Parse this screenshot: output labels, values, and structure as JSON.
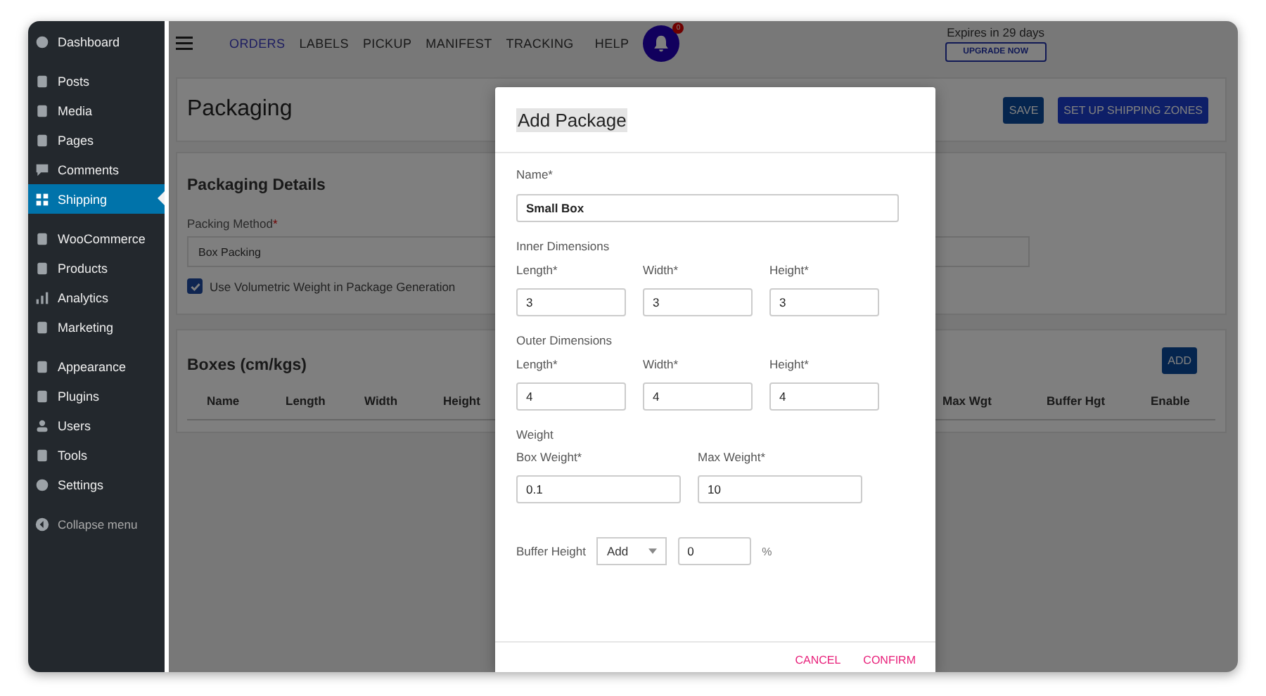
{
  "sidebar": {
    "groups": [
      [
        {
          "label": "Dashboard",
          "selected": false
        }
      ],
      [
        {
          "label": "Posts",
          "selected": false
        },
        {
          "label": "Media",
          "selected": false
        },
        {
          "label": "Pages",
          "selected": false
        },
        {
          "label": "Comments",
          "selected": false
        },
        {
          "label": "Shipping",
          "selected": true
        }
      ],
      [
        {
          "label": "WooCommerce",
          "selected": false
        },
        {
          "label": "Products",
          "selected": false
        },
        {
          "label": "Analytics",
          "selected": false
        },
        {
          "label": "Marketing",
          "selected": false
        }
      ],
      [
        {
          "label": "Appearance",
          "selected": false
        },
        {
          "label": "Plugins",
          "selected": false
        },
        {
          "label": "Users",
          "selected": false
        },
        {
          "label": "Tools",
          "selected": false
        },
        {
          "label": "Settings",
          "selected": false
        }
      ]
    ],
    "collapse": "Collapse menu"
  },
  "nav": {
    "items": [
      {
        "label": "ORDERS",
        "selected": true
      },
      {
        "label": "LABELS",
        "selected": false
      },
      {
        "label": "PICKUP",
        "selected": false
      },
      {
        "label": "MANIFEST",
        "selected": false
      },
      {
        "label": "TRACKING",
        "selected": false
      },
      {
        "label": "HELP",
        "selected": false
      }
    ],
    "notification_count": "0",
    "expiry": "Expires in 29 days",
    "upgrade": "UPGRADE NOW"
  },
  "page": {
    "title": "Packaging",
    "buttons": [
      "SAVE",
      "SET UP SHIPPING ZONES"
    ]
  },
  "details": {
    "title": "Packaging Details",
    "method_label": "Packing Method",
    "required_mark": "*",
    "method_value": "Box Packing",
    "volumetric": {
      "label": "Use Volumetric Weight in Package Generation",
      "checked": true
    }
  },
  "boxes": {
    "title": "Boxes (cm/kgs)",
    "add": "ADD",
    "columns": [
      "Name",
      "Length",
      "Width",
      "Height",
      "Max Wgt",
      "Buffer Hgt",
      "Enable"
    ]
  },
  "modal": {
    "title": "Add Package",
    "name_label": "Name*",
    "name_value": "Small Box",
    "inner": {
      "title": "Inner Dimensions",
      "fields": [
        {
          "label": "Length*",
          "value": "3"
        },
        {
          "label": "Width*",
          "value": "3"
        },
        {
          "label": "Height*",
          "value": "3"
        }
      ]
    },
    "outer": {
      "title": "Outer Dimensions",
      "fields": [
        {
          "label": "Length*",
          "value": "4"
        },
        {
          "label": "Width*",
          "value": "4"
        },
        {
          "label": "Height*",
          "value": "4"
        }
      ]
    },
    "weight": {
      "title": "Weight",
      "fields": [
        {
          "label": "Box Weight*",
          "value": "0.1"
        },
        {
          "label": "Max Weight*",
          "value": "10"
        }
      ]
    },
    "buffer": {
      "label": "Buffer Height",
      "mode": "Add",
      "value": "0",
      "unit": "%"
    },
    "actions": [
      "CANCEL",
      "CONFIRM"
    ]
  }
}
